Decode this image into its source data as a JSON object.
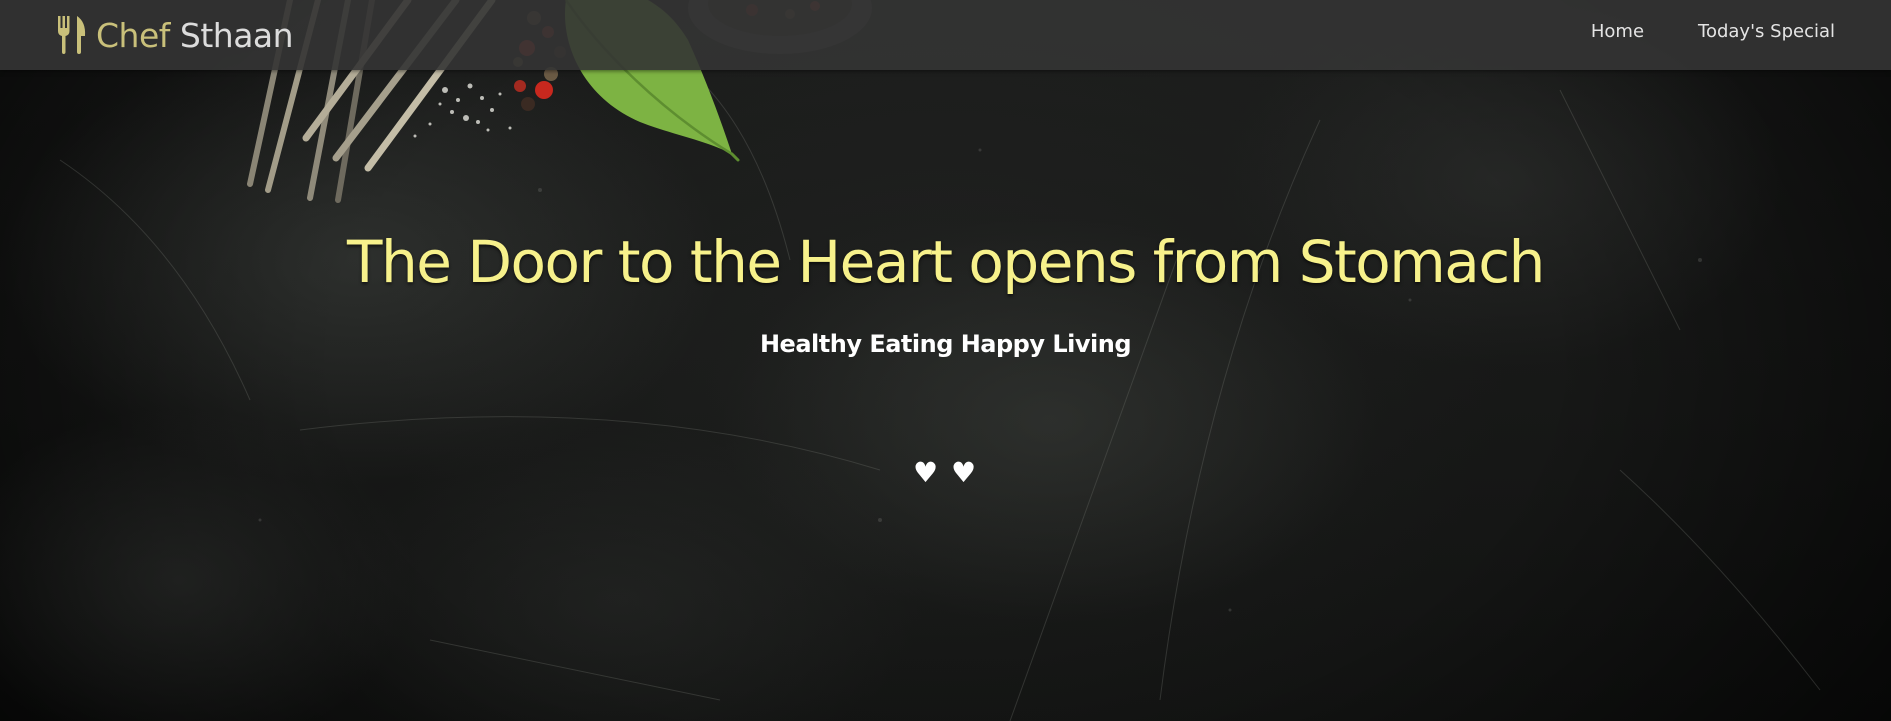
{
  "brand": {
    "name_part1": "Chef",
    "name_part2": "Sthaan",
    "icon": "fork-knife-icon"
  },
  "nav": {
    "items": [
      {
        "label": "Home"
      },
      {
        "label": "Today's Special"
      }
    ]
  },
  "hero": {
    "headline": "The Door to the Heart opens from Stomach",
    "tagline": "Healthy Eating Happy Living",
    "hearts": "♥ ♥",
    "background": "dark-slate-with-cutlery-herbs-peppercorns"
  },
  "colors": {
    "accent_yellow": "#f7f18b",
    "brand_gold": "#c9c07a",
    "navbar_bg": "#343434",
    "hero_bg": "#171817"
  }
}
